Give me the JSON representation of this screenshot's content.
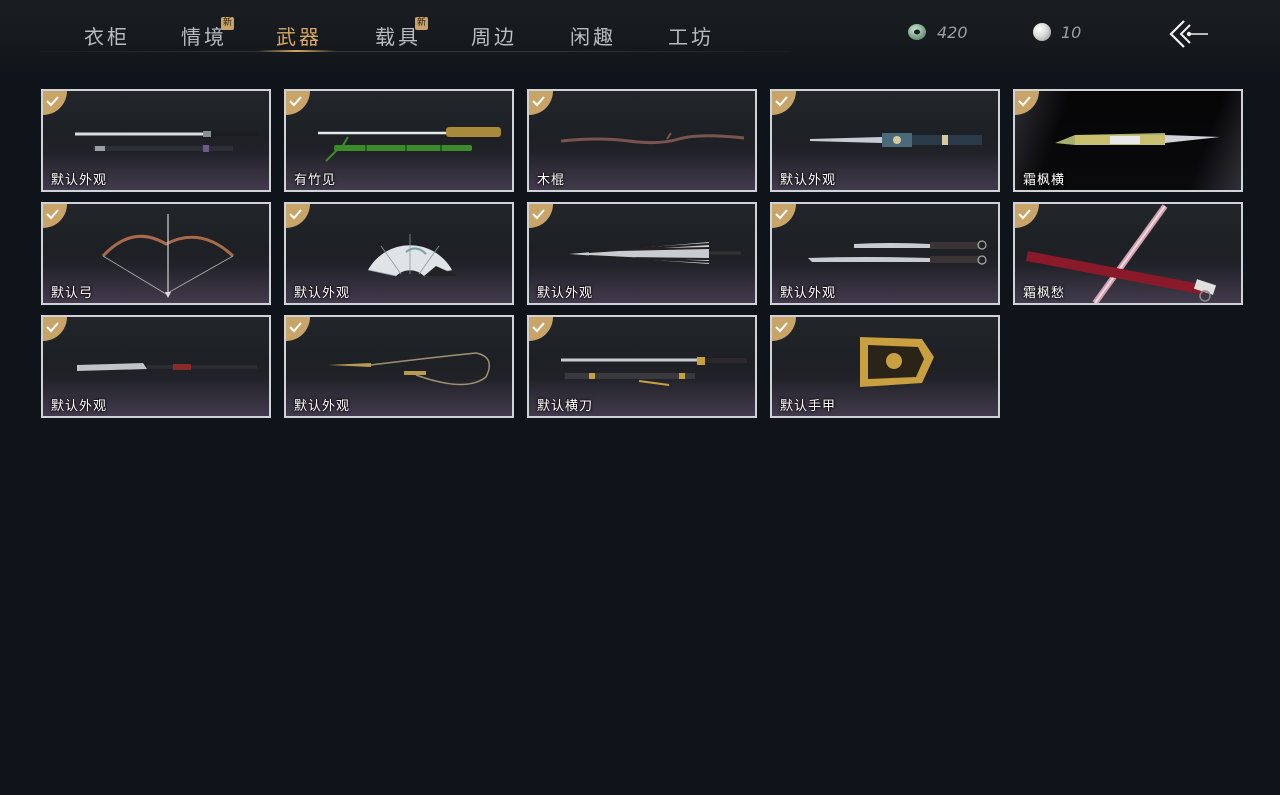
{
  "nav": {
    "tabs": [
      {
        "label": "衣柜",
        "new": false,
        "active": false
      },
      {
        "label": "情境",
        "new": true,
        "active": false
      },
      {
        "label": "武器",
        "new": false,
        "active": true
      },
      {
        "label": "载具",
        "new": true,
        "active": false
      },
      {
        "label": "周边",
        "new": false,
        "active": false
      },
      {
        "label": "闲趣",
        "new": false,
        "active": false
      },
      {
        "label": "工坊",
        "new": false,
        "active": false
      }
    ],
    "new_badge": "新"
  },
  "currency": {
    "jade": {
      "icon": "jade-coin-icon",
      "value": "420"
    },
    "pearl": {
      "icon": "pearl-icon",
      "value": "10"
    }
  },
  "back": {
    "icon": "back-arrow-icon"
  },
  "items": [
    {
      "name": "默认外观",
      "owned": true,
      "icon": "straight-sword-icon"
    },
    {
      "name": "有竹见",
      "owned": true,
      "icon": "bamboo-sword-icon"
    },
    {
      "name": "木棍",
      "owned": true,
      "icon": "wooden-staff-icon"
    },
    {
      "name": "默认外观",
      "owned": true,
      "icon": "ornate-blade-icon"
    },
    {
      "name": "霜枫横",
      "owned": true,
      "icon": "jade-blade-icon"
    },
    {
      "name": "默认弓",
      "owned": true,
      "icon": "bow-icon"
    },
    {
      "name": "默认外观",
      "owned": true,
      "icon": "fan-icon"
    },
    {
      "name": "默认外观",
      "owned": true,
      "icon": "umbrella-icon"
    },
    {
      "name": "默认外观",
      "owned": true,
      "icon": "twin-blades-icon"
    },
    {
      "name": "霜枫愁",
      "owned": true,
      "icon": "crimson-sword-icon"
    },
    {
      "name": "默认外观",
      "owned": true,
      "icon": "glaive-icon"
    },
    {
      "name": "默认外观",
      "owned": true,
      "icon": "rope-dart-icon"
    },
    {
      "name": "默认横刀",
      "owned": true,
      "icon": "hengdao-icon"
    },
    {
      "name": "默认手甲",
      "owned": true,
      "icon": "gauntlet-icon"
    }
  ],
  "colors": {
    "accent": "#d9a860",
    "check": "#c8a468",
    "border": "#cfd2d6",
    "bg": "#0f131a"
  }
}
